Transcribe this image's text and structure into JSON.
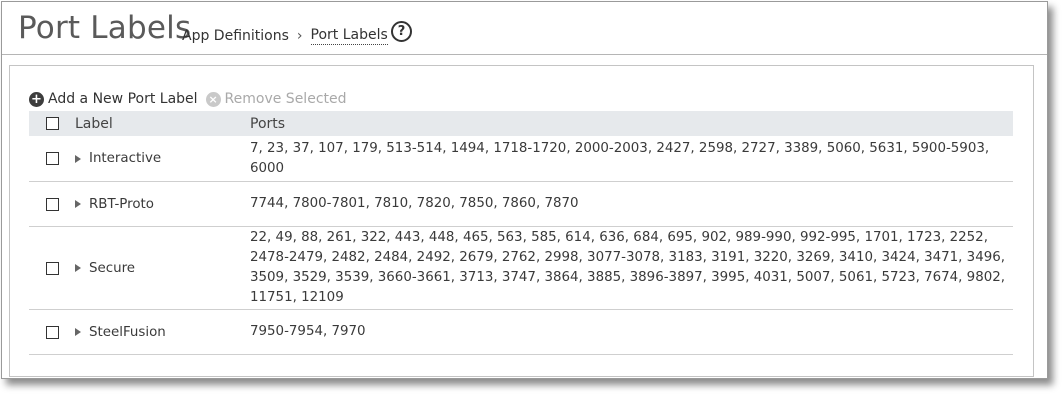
{
  "header": {
    "title": "Port Labels",
    "breadcrumb": {
      "parent": "App Definitions",
      "separator": "›",
      "current": "Port Labels"
    },
    "help_icon": "?"
  },
  "toolbar": {
    "add_label": "Add a New Port Label",
    "remove_label": "Remove Selected"
  },
  "table": {
    "columns": {
      "label": "Label",
      "ports": "Ports"
    },
    "rows": [
      {
        "label": "Interactive",
        "ports": "7, 23, 37, 107, 179, 513-514, 1494, 1718-1720, 2000-2003, 2427, 2598, 2727, 3389, 5060, 5631, 5900-5903, 6000"
      },
      {
        "label": "RBT-Proto",
        "ports": "7744, 7800-7801, 7810, 7820, 7850, 7860, 7870"
      },
      {
        "label": "Secure",
        "ports": "22, 49, 88, 261, 322, 443, 448, 465, 563, 585, 614, 636, 684, 695, 902, 989-990, 992-995, 1701, 1723, 2252, 2478-2479, 2482, 2484, 2492, 2679, 2762, 2998, 3077-3078, 3183, 3191, 3220, 3269, 3410, 3424, 3471, 3496, 3509, 3529, 3539, 3660-3661, 3713, 3747, 3864, 3885, 3896-3897, 3995, 4031, 5007, 5061, 5723, 7674, 9802, 11751, 12109"
      },
      {
        "label": "SteelFusion",
        "ports": "7950-7954, 7970"
      }
    ]
  }
}
